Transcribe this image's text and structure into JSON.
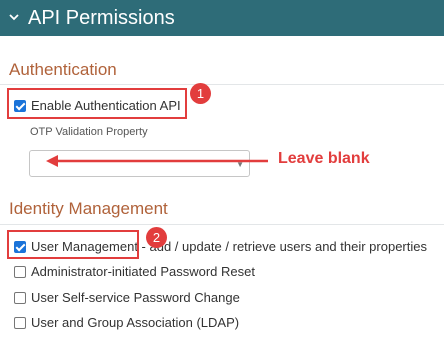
{
  "header": {
    "title": "API Permissions",
    "icon": "chevron-down-icon",
    "background": "#2e6c78"
  },
  "authentication": {
    "title": "Authentication",
    "enable_api": {
      "label": "Enable Authentication API",
      "checked": true
    },
    "otp_label": "OTP Validation Property",
    "otp_value": ""
  },
  "identity_management": {
    "title": "Identity Management",
    "options": [
      {
        "label": "User Management - add / update / retrieve users and their properties",
        "checked": true
      },
      {
        "label": "Administrator-initiated Password Reset",
        "checked": false
      },
      {
        "label": "User Self-service Password Change",
        "checked": false
      },
      {
        "label": "User and Group Association (LDAP)",
        "checked": false
      }
    ]
  },
  "annotations": {
    "badge_1": "1",
    "badge_2": "2",
    "note": "Leave blank",
    "color": "#e23d3d"
  }
}
